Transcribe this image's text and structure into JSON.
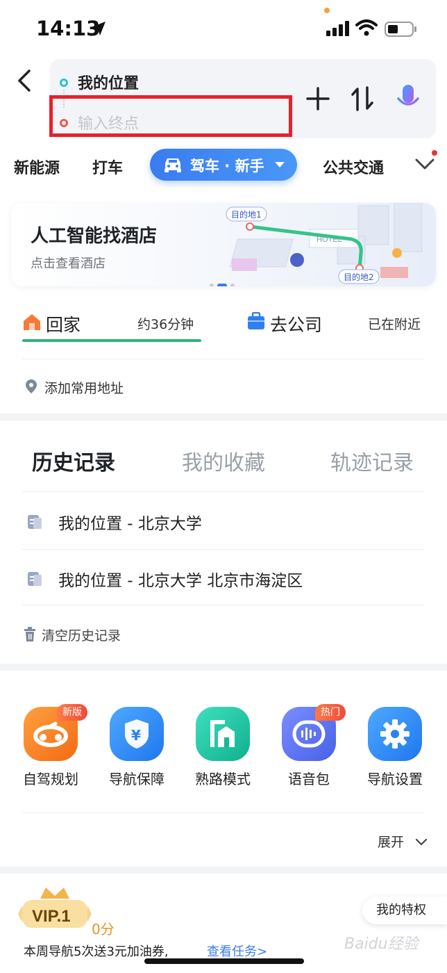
{
  "status_bar": {
    "time": "14:13"
  },
  "route": {
    "start": "我的位置",
    "end_placeholder": "输入终点"
  },
  "modes": {
    "items": [
      "新能源",
      "打车",
      "公共交通"
    ],
    "active": "驾车 · 新手"
  },
  "banner": {
    "title": "人工智能找酒店",
    "subtitle": "点击查看酒店",
    "pin1": "目的地1",
    "pin2": "目的地2",
    "hotel_sign": "HOTEL"
  },
  "shortcuts": {
    "home_label": "回家",
    "home_time": "约36分钟",
    "office_label": "去公司",
    "office_status": "已在附近",
    "add_address": "添加常用地址"
  },
  "history": {
    "tabs": [
      "历史记录",
      "我的收藏",
      "轨迹记录"
    ],
    "items": [
      "我的位置 - 北京大学",
      "我的位置 - 北京大学 北京市海淀区"
    ],
    "clear": "清空历史记录"
  },
  "tools": {
    "items": [
      {
        "label": "自驾规划",
        "tag": "新版",
        "color": "#f7821f"
      },
      {
        "label": "导航保障",
        "tag": "",
        "color": "#2f8ef5"
      },
      {
        "label": "熟路模式",
        "tag": "",
        "color": "#1fc4a3"
      },
      {
        "label": "语音包",
        "tag": "热门",
        "color": "#5a74ef"
      },
      {
        "label": "导航设置",
        "tag": "",
        "color": "#2f8ef5"
      }
    ],
    "expand": "展开"
  },
  "vip": {
    "level": "VIP.1",
    "score": "0分",
    "privilege": "我的特权",
    "task_text": "本周导航5次送3元加油券,",
    "task_link": "查看任务>"
  },
  "watermark": "Baidu经验"
}
